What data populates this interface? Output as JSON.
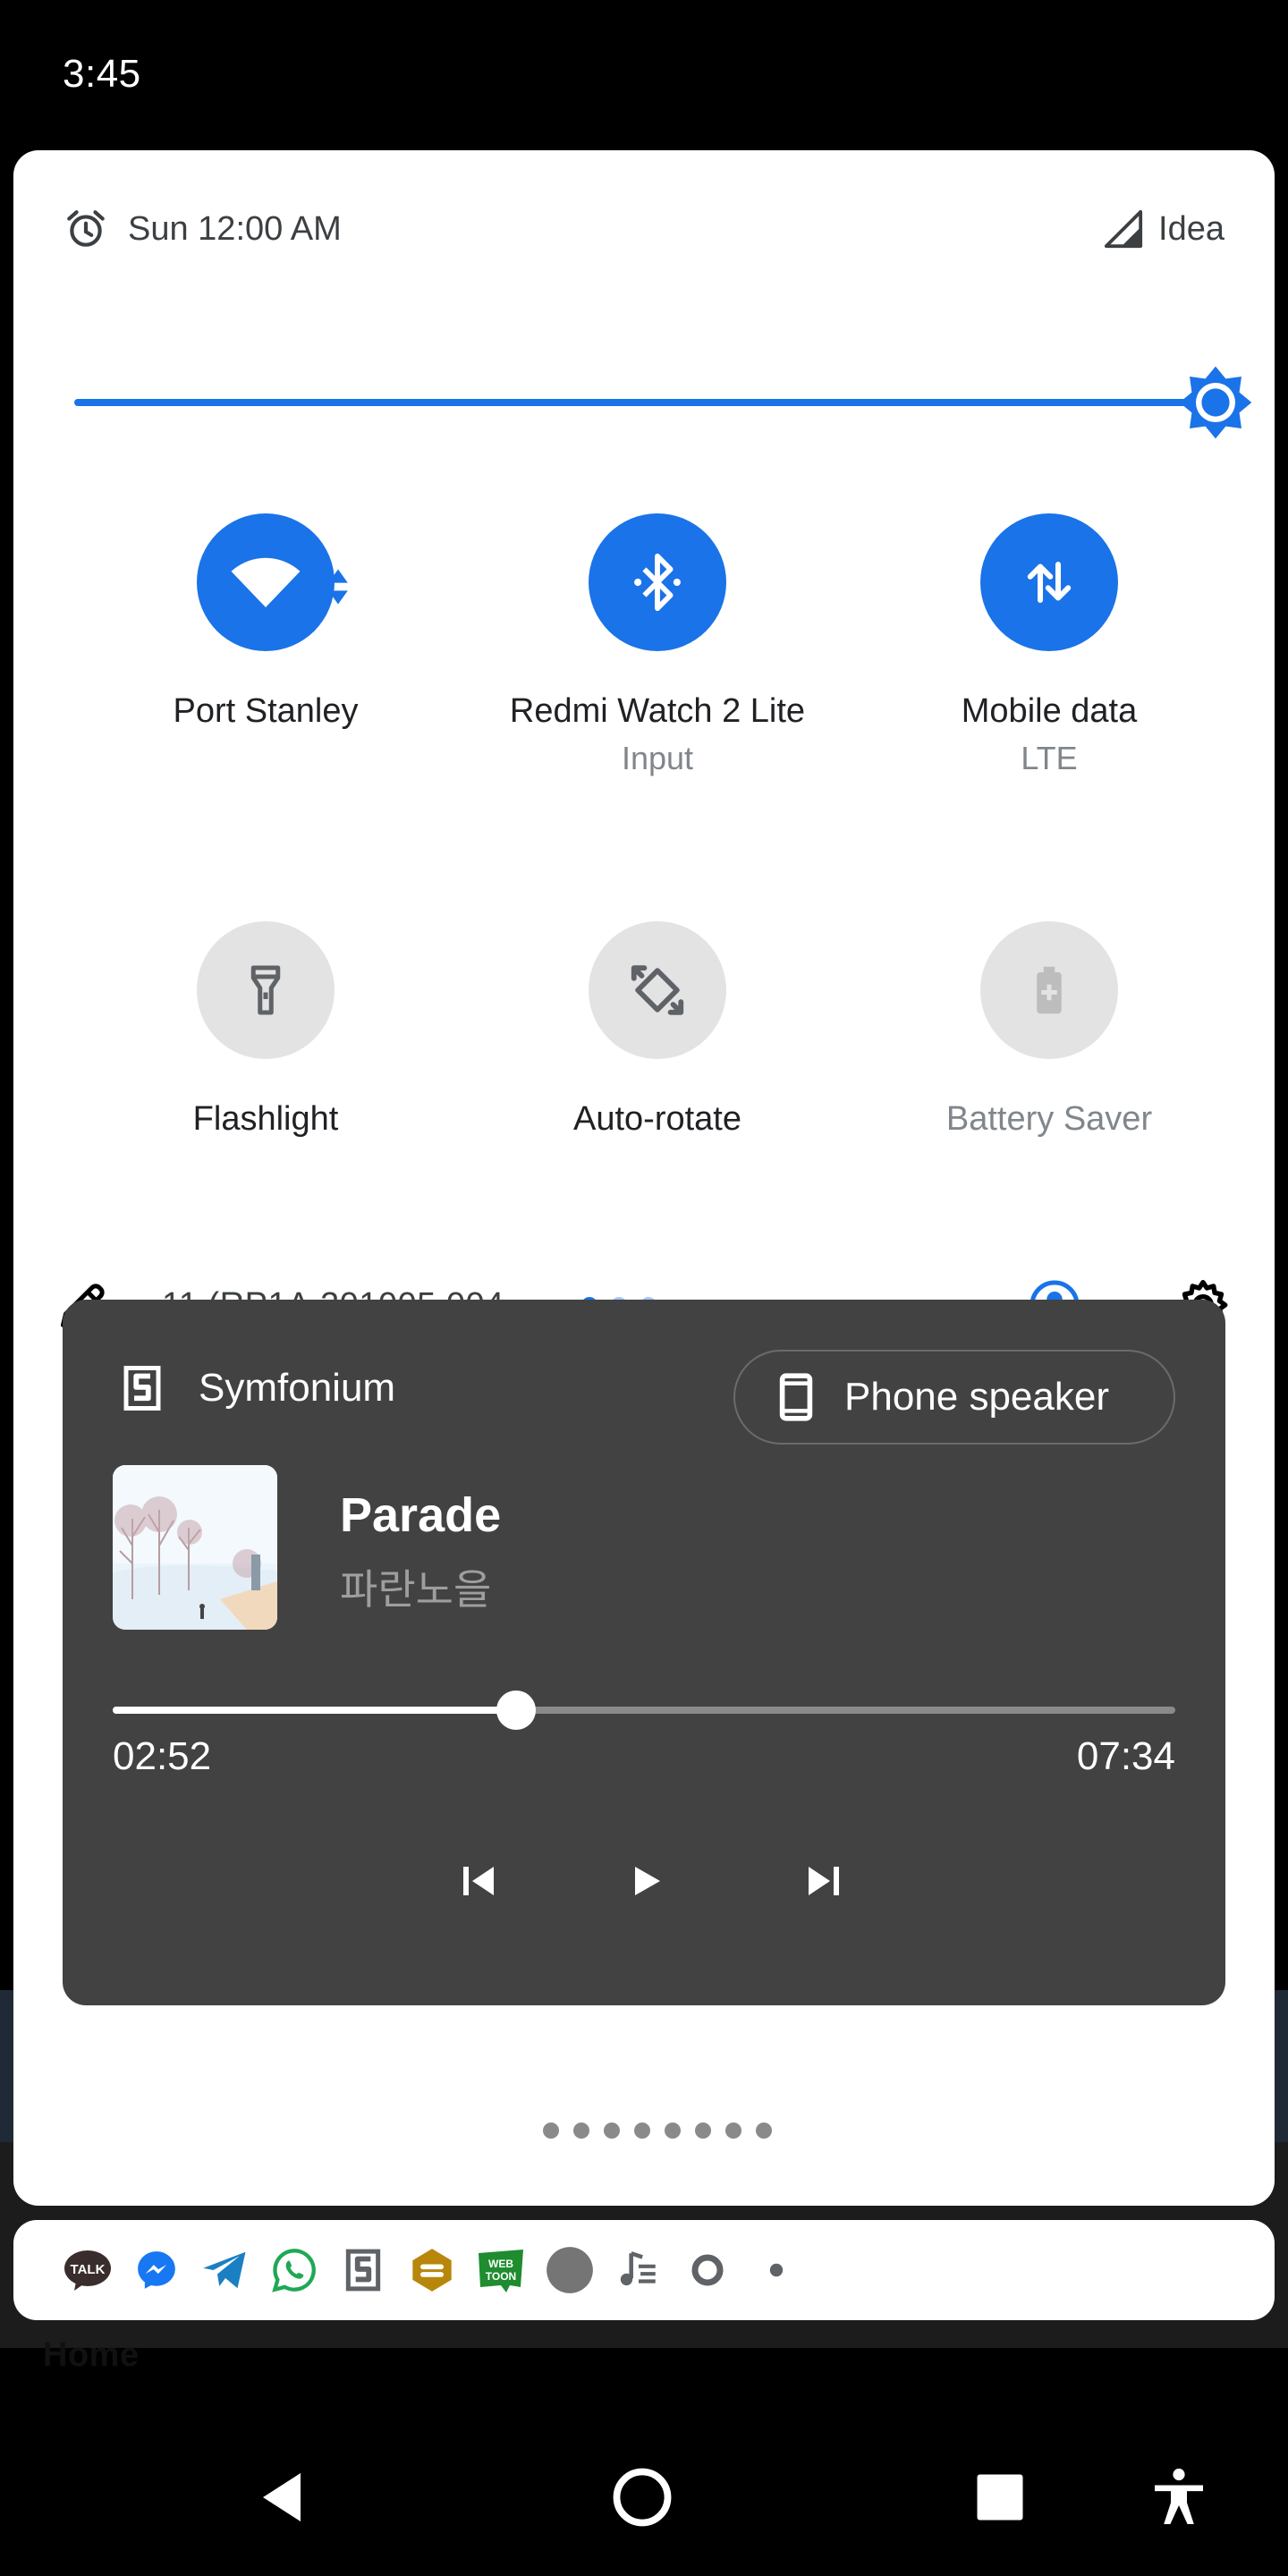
{
  "status_bar": {
    "time": "3:45"
  },
  "background_app": {
    "home_label": "Home"
  },
  "quick_settings": {
    "alarm_text": "Sun 12:00 AM",
    "carrier": "Idea",
    "brightness_level": 1.0,
    "tiles": [
      {
        "icon": "wifi-icon",
        "label": "Port Stanley",
        "sub": "",
        "state": "on"
      },
      {
        "icon": "bluetooth-icon",
        "label": "Redmi Watch 2 Lite",
        "sub": "Input",
        "state": "on"
      },
      {
        "icon": "mobile-data-icon",
        "label": "Mobile data",
        "sub": "LTE",
        "state": "on"
      },
      {
        "icon": "flashlight-icon",
        "label": "Flashlight",
        "sub": "",
        "state": "off"
      },
      {
        "icon": "auto-rotate-icon",
        "label": "Auto-rotate",
        "sub": "",
        "state": "off"
      },
      {
        "icon": "battery-saver-icon",
        "label": "Battery Saver",
        "sub": "",
        "state": "disabled"
      }
    ],
    "build_number": "11 (RP1A.201005.004....",
    "page_count": 3,
    "active_page": 0
  },
  "media": {
    "app_name": "Symfonium",
    "output_device": "Phone speaker",
    "title": "Parade",
    "artist": "파란노을",
    "elapsed": "02:52",
    "duration": "07:34",
    "progress": 0.38,
    "page_count": 9,
    "active_page": 0
  },
  "notification_icons": [
    "kakaotalk-icon",
    "messenger-icon",
    "telegram-icon",
    "whatsapp-icon",
    "symfonium-icon",
    "app-icon",
    "webtoon-icon",
    "circle-app-icon",
    "music-icon",
    "ring-icon",
    "more-dot-icon"
  ],
  "webtoon_icon_text": "WEB TOON",
  "kakao_icon_text": "TALK",
  "colors": {
    "accent": "#1a73e8",
    "panel_bg": "#ffffff",
    "media_bg": "#424242"
  }
}
